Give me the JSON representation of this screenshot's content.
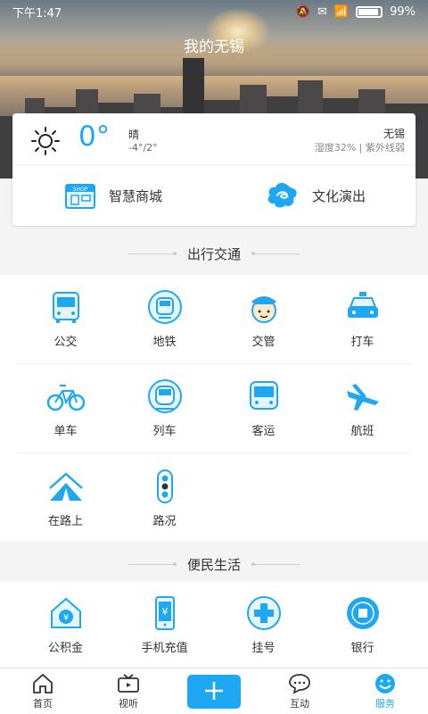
{
  "status": {
    "time": "下午1:47",
    "battery": "99%"
  },
  "header": {
    "title": "我的无锡"
  },
  "weather": {
    "temperature": "0°",
    "condition": "晴",
    "range": "-4°/2°",
    "city": "无锡",
    "details": "湿度32% | 紫外线弱"
  },
  "quick": [
    {
      "label": "智慧商城",
      "icon": "shop-icon"
    },
    {
      "label": "文化演出",
      "icon": "culture-icon"
    }
  ],
  "sections": {
    "traffic": {
      "title": "出行交通",
      "items": [
        {
          "label": "公交",
          "icon": "bus-icon"
        },
        {
          "label": "地铁",
          "icon": "metro-icon"
        },
        {
          "label": "交管",
          "icon": "traffic-police-icon"
        },
        {
          "label": "打车",
          "icon": "taxi-icon"
        },
        {
          "label": "单车",
          "icon": "bicycle-icon"
        },
        {
          "label": "列车",
          "icon": "train-icon"
        },
        {
          "label": "客运",
          "icon": "coach-icon"
        },
        {
          "label": "航班",
          "icon": "flight-icon"
        },
        {
          "label": "在路上",
          "icon": "on-the-road-icon"
        },
        {
          "label": "路况",
          "icon": "traffic-light-icon"
        }
      ]
    },
    "life": {
      "title": "便民生活",
      "items": [
        {
          "label": "公积金",
          "icon": "housing-fund-icon"
        },
        {
          "label": "手机充值",
          "icon": "phone-recharge-icon"
        },
        {
          "label": "挂号",
          "icon": "hospital-icon"
        },
        {
          "label": "银行",
          "icon": "bank-icon"
        }
      ]
    }
  },
  "nav": [
    {
      "label": "首页",
      "icon": "home-icon"
    },
    {
      "label": "视听",
      "icon": "tv-icon"
    },
    {
      "label": "",
      "icon": "plus-icon"
    },
    {
      "label": "互动",
      "icon": "chat-icon"
    },
    {
      "label": "服务",
      "icon": "smile-icon"
    }
  ],
  "colors": {
    "accent": "#1ea8f3"
  }
}
